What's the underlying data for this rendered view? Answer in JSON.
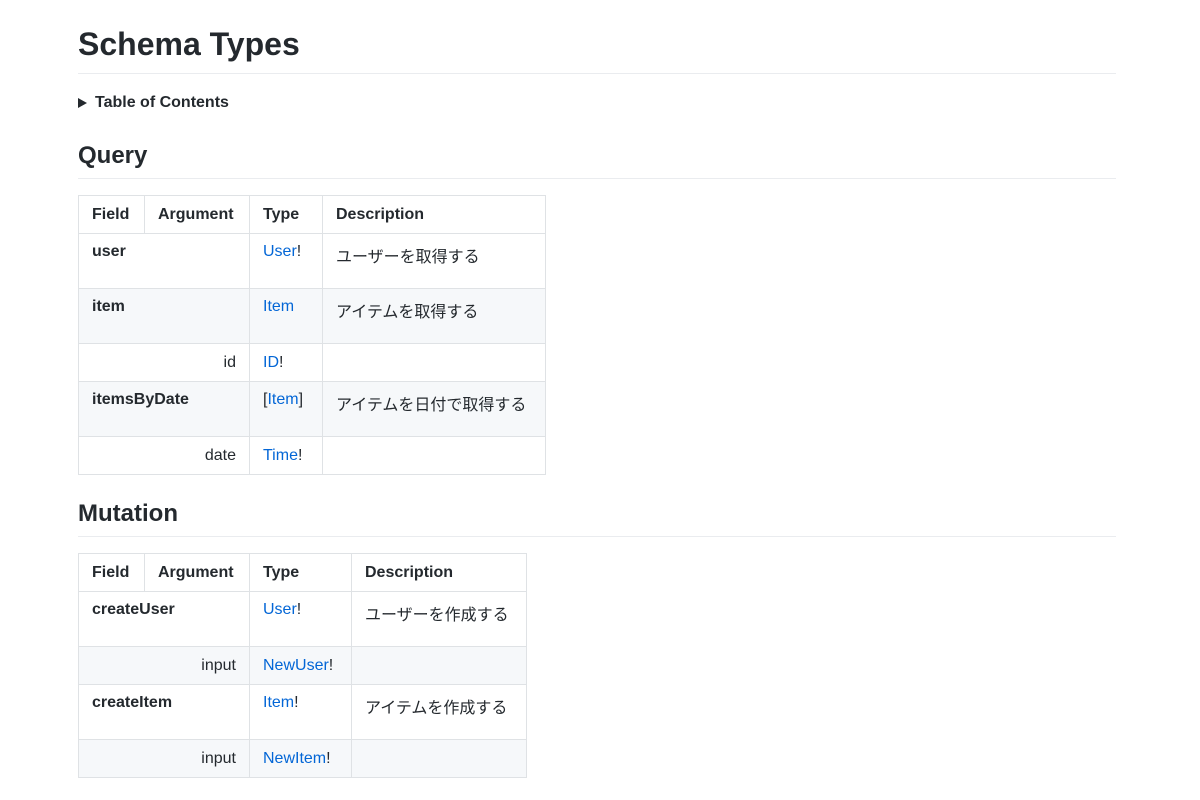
{
  "page": {
    "title": "Schema Types",
    "toc_label": "Table of Contents"
  },
  "query": {
    "heading": "Query",
    "headers": [
      "Field",
      "Argument",
      "Type",
      "Description"
    ],
    "rows": [
      {
        "field": "user",
        "type_prefix": "",
        "type_name": "User",
        "type_suffix": "!",
        "description": "ユーザーを取得する"
      },
      {
        "field": "item",
        "type_prefix": "",
        "type_name": "Item",
        "type_suffix": "",
        "description": "アイテムを取得する"
      },
      {
        "arg": "id",
        "type_prefix": "",
        "type_name": "ID",
        "type_suffix": "!",
        "description": ""
      },
      {
        "field": "itemsByDate",
        "type_prefix": "[",
        "type_name": "Item",
        "type_suffix": "]",
        "description": "アイテムを日付で取得する"
      },
      {
        "arg": "date",
        "type_prefix": "",
        "type_name": "Time",
        "type_suffix": "!",
        "description": ""
      }
    ]
  },
  "mutation": {
    "heading": "Mutation",
    "headers": [
      "Field",
      "Argument",
      "Type",
      "Description"
    ],
    "rows": [
      {
        "field": "createUser",
        "type_prefix": "",
        "type_name": "User",
        "type_suffix": "!",
        "description": "ユーザーを作成する"
      },
      {
        "arg": "input",
        "type_prefix": "",
        "type_name": "NewUser",
        "type_suffix": "!",
        "description": ""
      },
      {
        "field": "createItem",
        "type_prefix": "",
        "type_name": "Item",
        "type_suffix": "!",
        "description": "アイテムを作成する"
      },
      {
        "arg": "input",
        "type_prefix": "",
        "type_name": "NewItem",
        "type_suffix": "!",
        "description": ""
      }
    ]
  },
  "colors": {
    "link": "#0366d6",
    "text": "#24292e",
    "border": "#dfe2e5",
    "alt_row": "#f6f8fa"
  }
}
